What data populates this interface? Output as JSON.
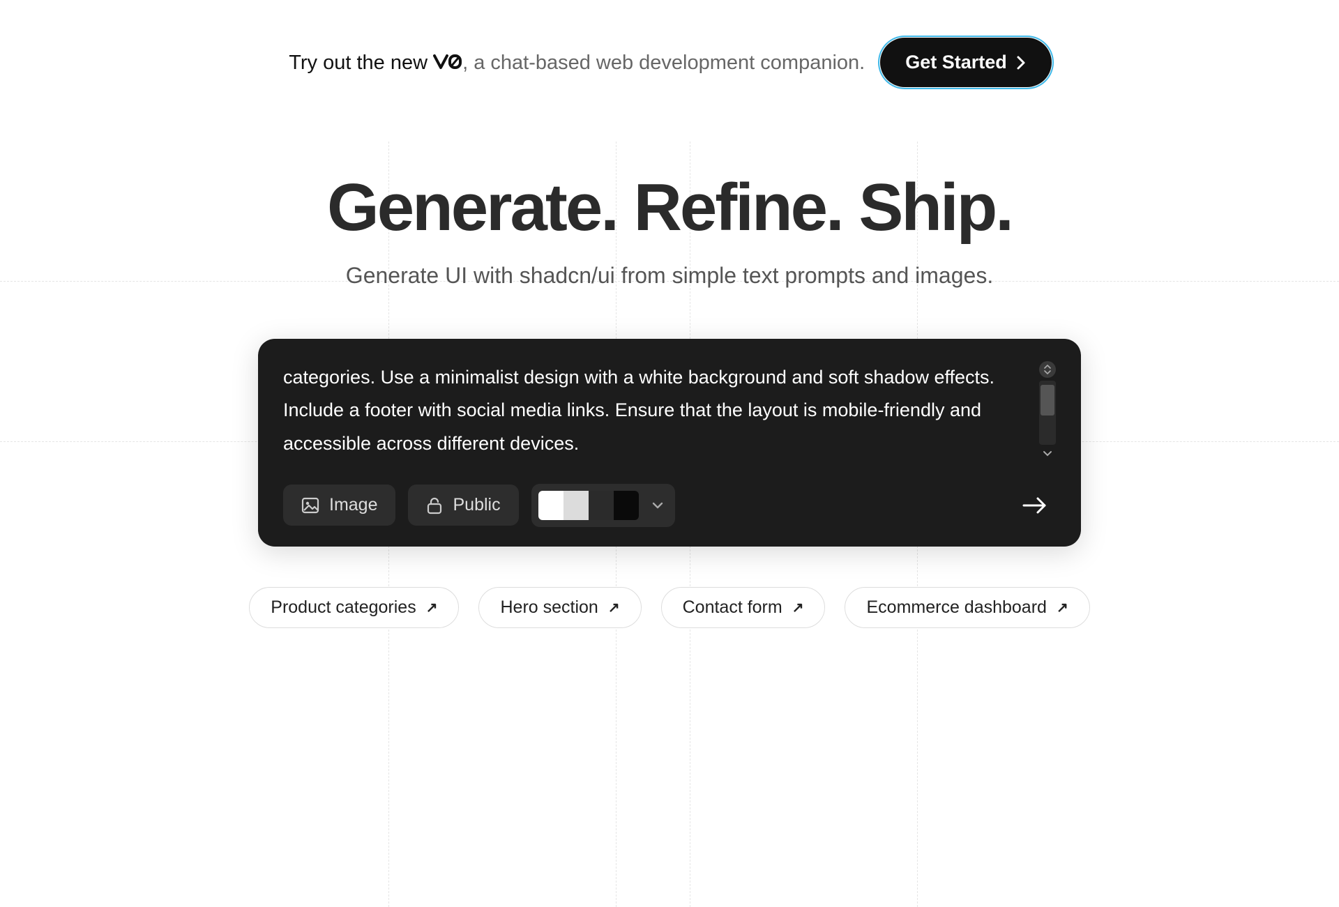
{
  "banner": {
    "prefix": "Try out the new ",
    "logo_text": "v0",
    "suffix": ", a chat-based web development companion.",
    "cta_label": "Get Started"
  },
  "hero": {
    "title": "Generate. Refine. Ship.",
    "subtitle": "Generate UI with shadcn/ui from simple text prompts and images."
  },
  "prompt": {
    "text": "categories. Use a minimalist design with a white background and soft shadow effects. Include a footer with social media links. Ensure that the layout is mobile-friendly and accessible across different devices.",
    "image_label": "Image",
    "public_label": "Public",
    "palette": [
      "#ffffff",
      "#dcdcdc",
      "#2b2b2b",
      "#0a0a0a"
    ]
  },
  "chips": [
    "Product categories",
    "Hero section",
    "Contact form",
    "Ecommerce dashboard"
  ]
}
